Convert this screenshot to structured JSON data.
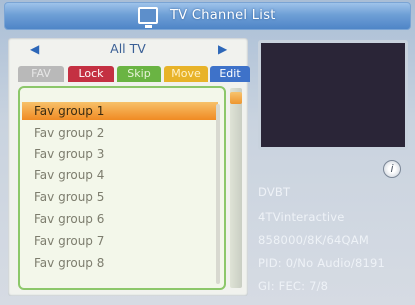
{
  "header": {
    "title": "TV Channel List",
    "icon": "tv-icon"
  },
  "group_selector": {
    "label": "All TV",
    "left_icon": "arrow-left-icon",
    "right_icon": "arrow-right-icon"
  },
  "tabs": [
    {
      "label": "FAV",
      "color": "#b9b9b9"
    },
    {
      "label": "Lock",
      "color": "#c43042"
    },
    {
      "label": "Skip",
      "color": "#6ab443"
    },
    {
      "label": "Move",
      "color": "#e8b329"
    },
    {
      "label": "Edit",
      "color": "#3e72c9"
    }
  ],
  "list": {
    "selected_index": 0,
    "items": [
      "Fav group 1",
      "Fav group 2",
      "Fav group 3",
      "Fav group 4",
      "Fav group 5",
      "Fav group 6",
      "Fav group 7",
      "Fav group 8"
    ]
  },
  "info": {
    "icon": "info-icon",
    "system": "DVBT",
    "channel": "4TVinteractive",
    "params": "858000/8K/64QAM",
    "pid": "PID: 0/No Audio/8191",
    "gi": "GI:  FEC: 7/8"
  },
  "colors": {
    "selection": "#f08a23",
    "panel_border": "#8cc76a",
    "title_bar": "#4f85c7"
  }
}
